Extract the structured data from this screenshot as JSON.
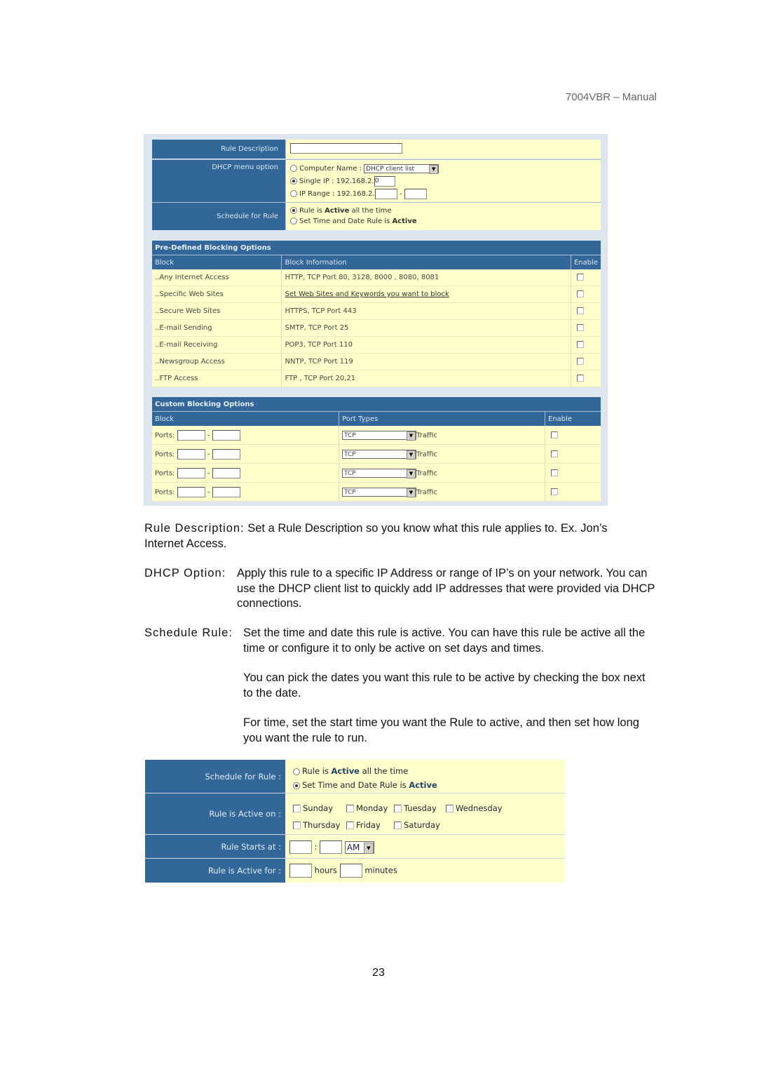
{
  "header": {
    "manual_title": "7004VBR – Manual"
  },
  "rule_form": {
    "rule_description": {
      "label": "Rule Description",
      "value": ""
    },
    "dhcp_menu_option": {
      "label": "DHCP menu option",
      "computer_name_label": "Computer Name :",
      "computer_name_select": "DHCP client list",
      "single_ip_label": "Single IP : 192.168.2.",
      "single_ip_value": "0",
      "ip_range_label": "IP Range : 192.168.2.",
      "ip_range_sep": "-",
      "selected": "single_ip"
    },
    "schedule": {
      "label": "Schedule for Rule",
      "opt_always_prefix": "Rule is ",
      "opt_always_bold": "Active",
      "opt_always_suffix": " all the time",
      "opt_set_prefix": "Set Time and Date Rule is ",
      "opt_set_bold": "Active",
      "selected": "always"
    }
  },
  "predefined": {
    "title": "Pre-Defined Blocking Options",
    "headers": [
      "Block",
      "Block Information",
      "Enable"
    ],
    "rows": [
      {
        "block": "Any Internet Access",
        "info": "HTTP, TCP Port 80, 3128, 8000 , 8080, 8081",
        "link": false,
        "enabled": false
      },
      {
        "block": "Specific Web Sites",
        "info": "Set Web Sites and Keywords you want to block",
        "link": true,
        "enabled": false
      },
      {
        "block": "Secure Web Sites",
        "info": "HTTPS, TCP Port 443",
        "link": false,
        "enabled": false
      },
      {
        "block": "E-mail Sending",
        "info": "SMTP, TCP Port 25",
        "link": false,
        "enabled": false
      },
      {
        "block": "E-mail Receiving",
        "info": "POP3, TCP Port 110",
        "link": false,
        "enabled": false
      },
      {
        "block": "Newsgroup Access",
        "info": "NNTP, TCP Port 119",
        "link": false,
        "enabled": false
      },
      {
        "block": "FTP Access",
        "info": "FTP , TCP Port 20,21",
        "link": false,
        "enabled": false
      }
    ]
  },
  "custom": {
    "title": "Custom Blocking Options",
    "headers": [
      "Block",
      "Port Types",
      "Enable"
    ],
    "ports_label": "Ports:",
    "sep": "-",
    "traffic_label": "Traffic",
    "rows": [
      {
        "from": "",
        "to": "",
        "type": "TCP",
        "enabled": false
      },
      {
        "from": "",
        "to": "",
        "type": "TCP",
        "enabled": false
      },
      {
        "from": "",
        "to": "",
        "type": "TCP",
        "enabled": false
      },
      {
        "from": "",
        "to": "",
        "type": "TCP",
        "enabled": false
      }
    ]
  },
  "descriptions": {
    "rule_desc_term": "Rule Description:",
    "rule_desc_text": "Set a Rule Description so you know what this rule applies to. Ex. Jon’s Internet Access.",
    "dhcp_term": "DHCP Option:",
    "dhcp_text": "Apply this rule to a specific IP Address or range of IP’s on your network. You can use the DHCP client list to quickly add IP addresses that were provided via DHCP connections.",
    "schedule_term": "Schedule Rule:",
    "schedule_text_1": "Set the time and date this rule is active.  You can have this rule be active all the time or configure it to only be active on set days and times.",
    "schedule_text_2": "You can pick the dates you want this rule to be active by checking the box next to the date.",
    "schedule_text_3": "For time, set the start time you want the Rule to active, and then set how long you want the rule to run."
  },
  "schedule_form": {
    "schedule_label": "Schedule for Rule :",
    "opt_always_prefix": "Rule is ",
    "opt_always_bold": "Active",
    "opt_always_suffix": " all the time",
    "opt_set_prefix": "Set Time and Date Rule is ",
    "opt_set_bold": "Active",
    "selected": "set",
    "active_on_label": "Rule is Active on :",
    "days": [
      "Sunday",
      "Monday",
      "Tuesday",
      "Wednesday",
      "Thursday",
      "Friday",
      "Saturday"
    ],
    "starts_label": "Rule Starts at :",
    "start_hour": "",
    "start_min": "",
    "time_sep": ":",
    "ampm": "AM",
    "active_for_label": "Rule is Active for :",
    "hours_label": "hours",
    "minutes_label": "minutes",
    "hours_value": "",
    "minutes_value": ""
  },
  "footer": {
    "page_number": "23"
  }
}
